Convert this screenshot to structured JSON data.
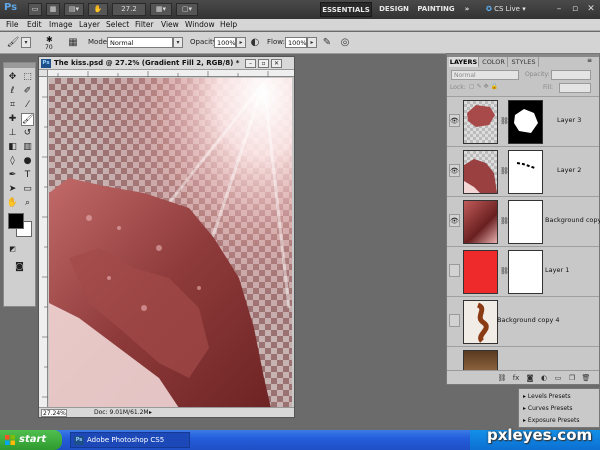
{
  "appbar": {
    "logo": "Ps",
    "zoom": "27.2",
    "workspaces": [
      "ESSENTIALS",
      "DESIGN",
      "PAINTING",
      "»"
    ],
    "cs_live": "CS Live"
  },
  "menu": [
    "File",
    "Edit",
    "Image",
    "Layer",
    "Select",
    "Filter",
    "View",
    "Window",
    "Help"
  ],
  "options": {
    "brush_size": "70",
    "mode_label": "Mode:",
    "mode_value": "Normal",
    "opacity_label": "Opacity:",
    "opacity_value": "100%",
    "flow_label": "Flow:",
    "flow_value": "100%"
  },
  "document": {
    "title": "The kiss.psd @ 27.2% (Gradient Fill 2, RGB/8) *",
    "ps_icon": "Ps",
    "zoom": "27.24%",
    "doc_size": "Doc: 9.01M/61.2M"
  },
  "layers_panel": {
    "tabs": [
      "LAYERS",
      "COLOR",
      "STYLES"
    ],
    "blend_mode": "Normal",
    "opacity_label": "Opacity:",
    "lock_label": "Lock:",
    "fill_label": "Fill:",
    "layers": [
      {
        "name": "Layer 3",
        "visible": true
      },
      {
        "name": "Layer 2",
        "visible": true
      },
      {
        "name": "Background copy",
        "visible": true
      },
      {
        "name": "Layer 1",
        "visible": false
      },
      {
        "name": "Background copy 4",
        "visible": false
      },
      {
        "name": "",
        "visible": false
      }
    ]
  },
  "presets": [
    "Levels Presets",
    "Curves Presets",
    "Exposure Presets"
  ],
  "taskbar": {
    "start": "start",
    "task": "Adobe Photoshop CS5"
  },
  "watermark": "pxleyes.com",
  "colors": {
    "foreground": "#000000",
    "background": "#ffffff",
    "layer1_fill": "#ef2a2a"
  }
}
